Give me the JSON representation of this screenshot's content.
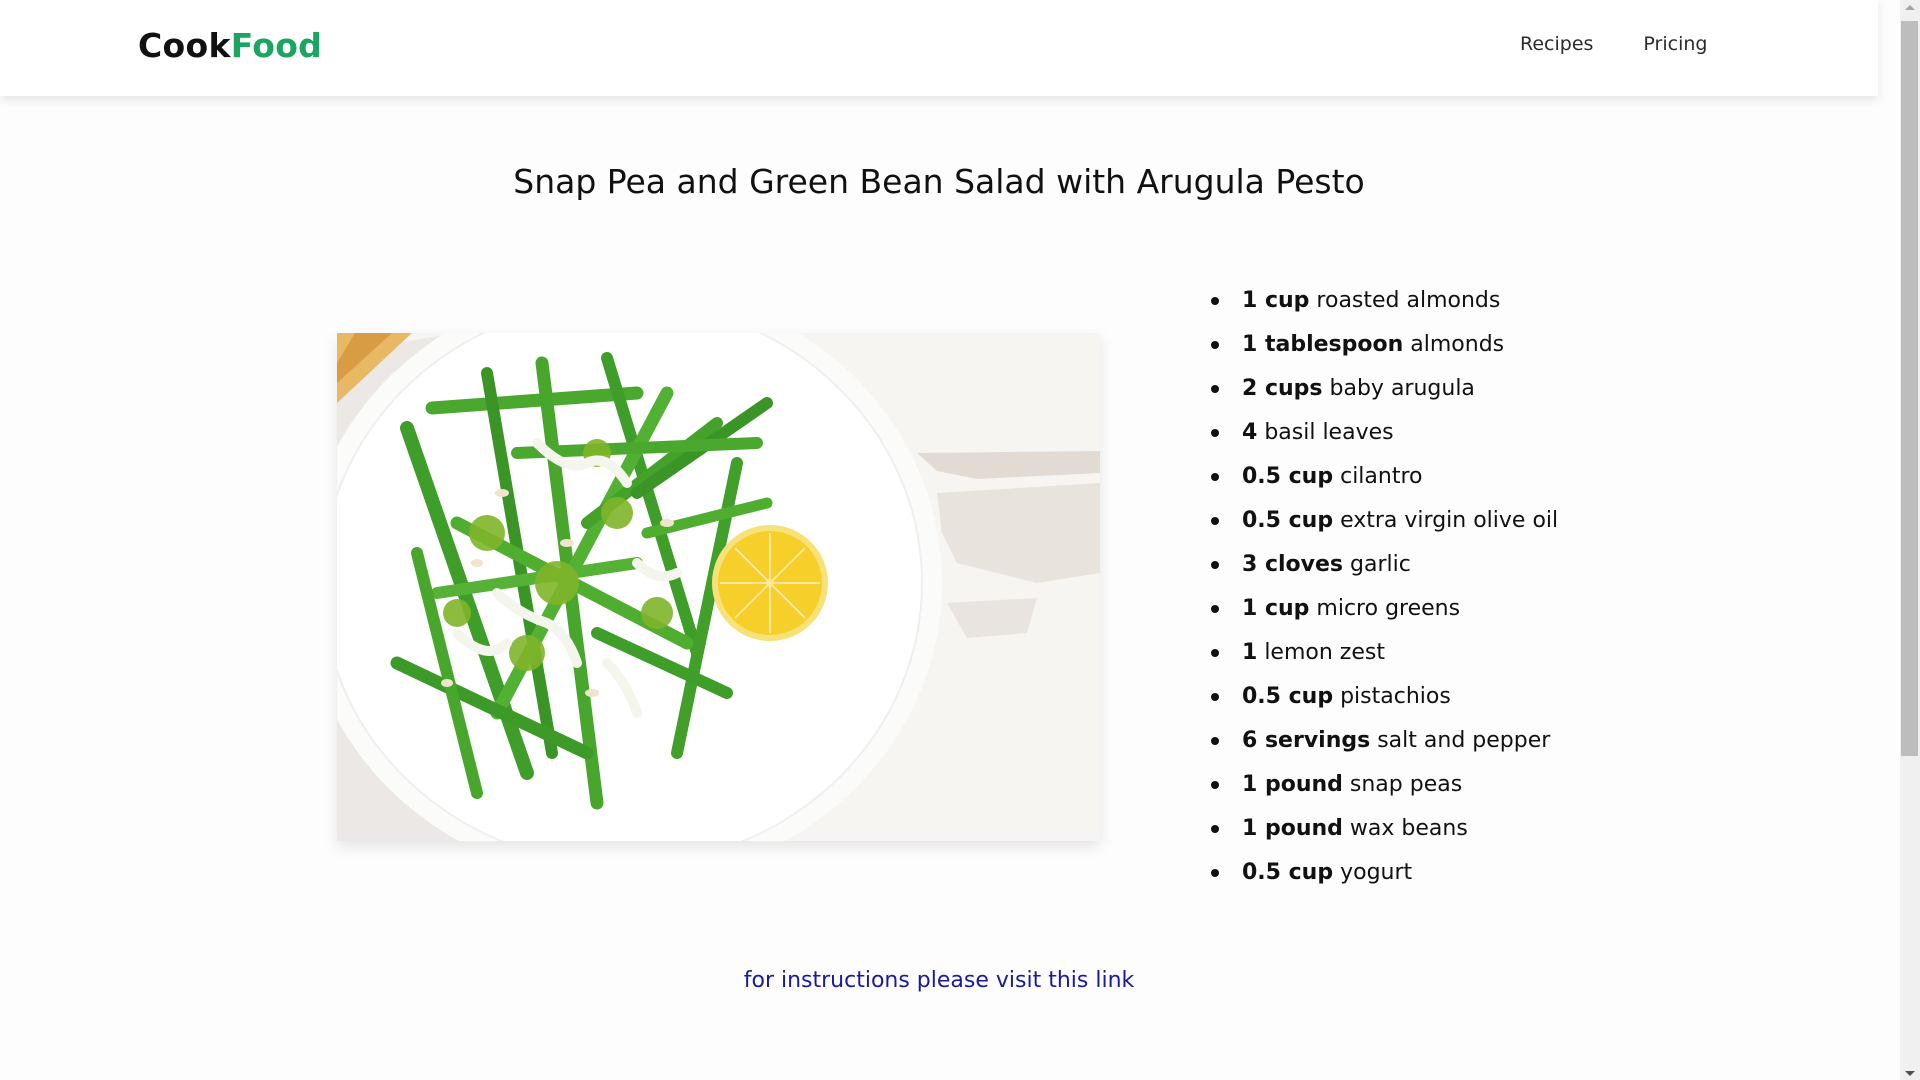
{
  "header": {
    "logo": {
      "part1": "Cook",
      "part2": "Food"
    },
    "nav": [
      {
        "label": "Recipes"
      },
      {
        "label": "Pricing"
      }
    ]
  },
  "recipe": {
    "title": "Snap Pea and Green Bean Salad with Arugula Pesto",
    "image_alt": "Green beans with pesto, yogurt drizzle and half a lemon on a white plate",
    "ingredients": [
      {
        "qty": "1 cup",
        "name": "roasted almonds"
      },
      {
        "qty": "1 tablespoon",
        "name": "almonds"
      },
      {
        "qty": "2 cups",
        "name": "baby arugula"
      },
      {
        "qty": "4",
        "name": "basil leaves"
      },
      {
        "qty": "0.5 cup",
        "name": "cilantro"
      },
      {
        "qty": "0.5 cup",
        "name": "extra virgin olive oil"
      },
      {
        "qty": "3 cloves",
        "name": "garlic"
      },
      {
        "qty": "1 cup",
        "name": "micro greens"
      },
      {
        "qty": "1",
        "name": "lemon zest"
      },
      {
        "qty": "0.5 cup",
        "name": "pistachios"
      },
      {
        "qty": "6 servings",
        "name": "salt and pepper"
      },
      {
        "qty": "1 pound",
        "name": "snap peas"
      },
      {
        "qty": "1 pound",
        "name": "wax beans"
      },
      {
        "qty": "0.5 cup",
        "name": "yogurt"
      }
    ],
    "instructions_link": "for instructions please visit this link"
  },
  "colors": {
    "brand_green": "#1aa561",
    "link_blue": "#1a1a9c"
  }
}
